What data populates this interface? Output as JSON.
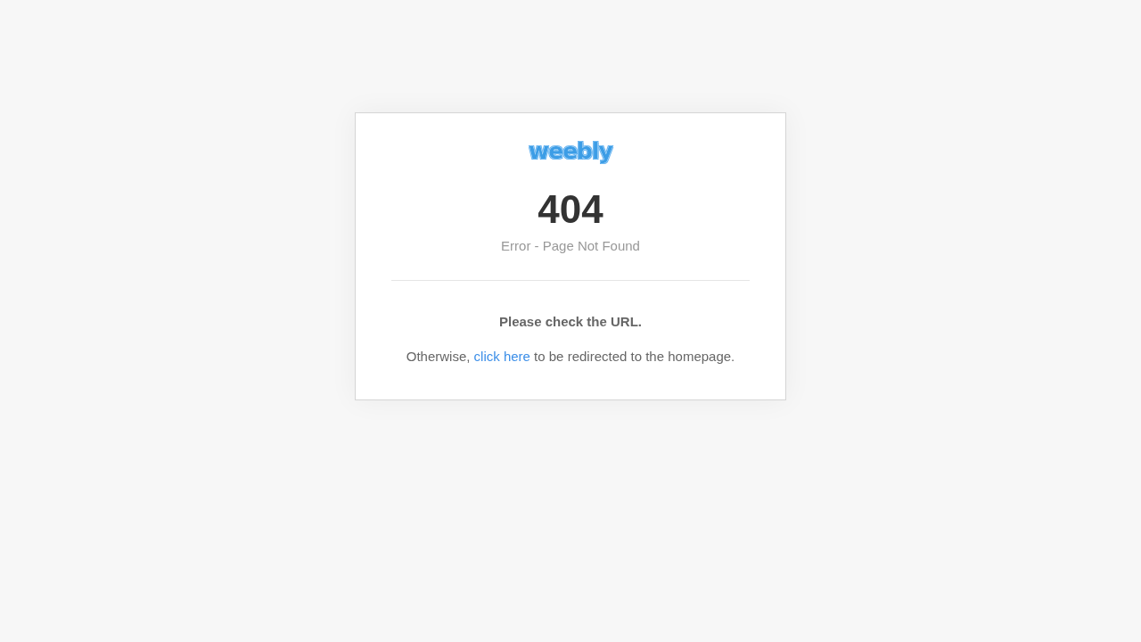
{
  "logo": "weebly",
  "code": "404",
  "subtitle": "Error - Page Not Found",
  "notice": "Please check the URL.",
  "redirect": {
    "before": "Otherwise, ",
    "link": "click here",
    "after": " to be redirected to the homepage."
  }
}
